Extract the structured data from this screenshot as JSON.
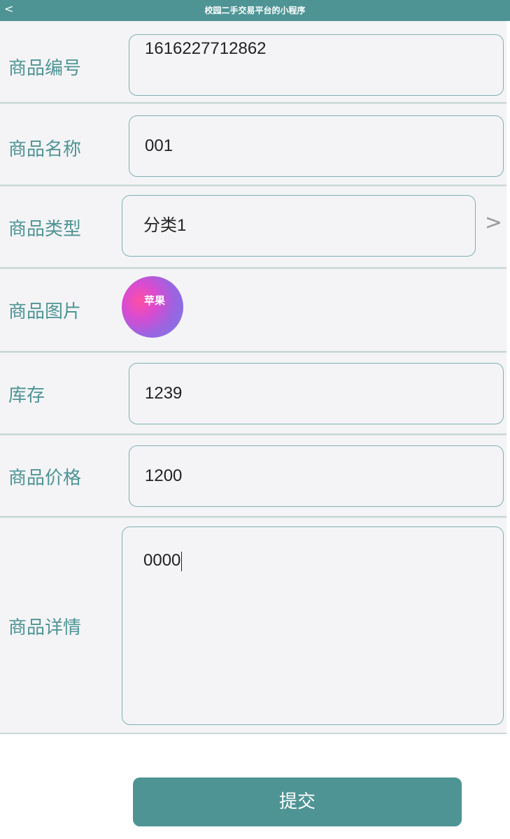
{
  "navbar": {
    "back_glyph": "<",
    "title": "校园二手交易平台的小程序"
  },
  "form": {
    "fields": [
      {
        "label": "商品编号",
        "value": "1616227712862"
      },
      {
        "label": "商品名称",
        "value": "001"
      },
      {
        "label": "商品类型",
        "value": "分类1",
        "chevron": ">"
      },
      {
        "label": "商品图片",
        "thumb_text": "苹果"
      },
      {
        "label": "库存",
        "value": "1239"
      },
      {
        "label": "商品价格",
        "value": "1200"
      },
      {
        "label": "商品详情",
        "value": "0000"
      }
    ]
  },
  "submit_label": "提交"
}
